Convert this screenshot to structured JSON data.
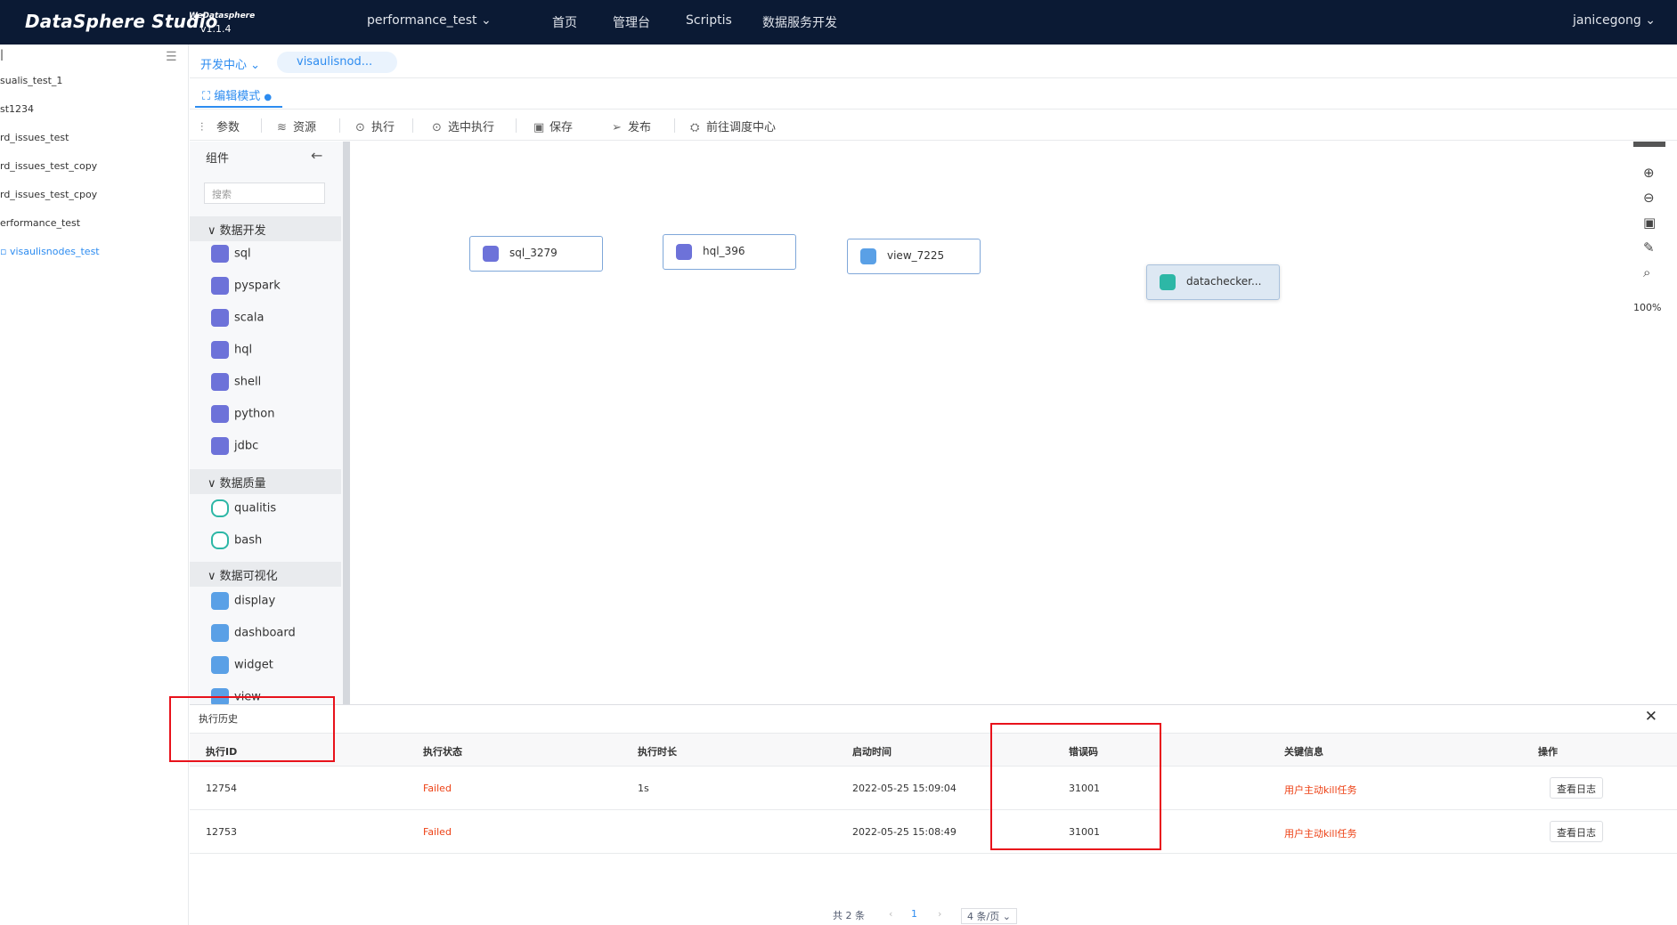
{
  "app": {
    "name": "DataSphere Studio",
    "superscript": "WeDatasphere",
    "version": "v1.1.4"
  },
  "header": {
    "project": "performance_test",
    "nav": [
      "首页",
      "管理台",
      "Scriptis",
      "数据服务开发"
    ],
    "user": "janicegong"
  },
  "workflows": [
    "sualis_test_1",
    "st1234",
    "rd_issues_test",
    "rd_issues_test_copy",
    "rd_issues_test_cpoy",
    "erformance_test",
    "visaulisnodes_test"
  ],
  "tabs": {
    "dev_center": "开发中心",
    "file_tab": "visaulisnod...",
    "mode": "编辑模式"
  },
  "toolbar": [
    "参数",
    "资源",
    "执行",
    "选中执行",
    "保存",
    "发布",
    "前往调度中心"
  ],
  "palette": {
    "title": "组件",
    "search_placeholder": "搜索",
    "groups": [
      {
        "name": "数据开发",
        "items": [
          "sql",
          "pyspark",
          "scala",
          "hql",
          "shell",
          "python",
          "jdbc"
        ]
      },
      {
        "name": "数据质量",
        "items": [
          "qualitis",
          "bash"
        ]
      },
      {
        "name": "数据可视化",
        "items": [
          "display",
          "dashboard",
          "widget",
          "view"
        ]
      }
    ]
  },
  "nodes": [
    "sql_3279",
    "hql_396",
    "view_7225",
    "datachecker..."
  ],
  "canvas": {
    "zoom": "100%"
  },
  "history": {
    "title": "执行历史",
    "columns": [
      "执行ID",
      "执行状态",
      "执行时长",
      "启动时间",
      "错误码",
      "关键信息",
      "操作"
    ],
    "rows": [
      {
        "id": "12754",
        "status": "Failed",
        "duration": "1s",
        "start": "2022-05-25 15:09:04",
        "code": "31001",
        "info": "用户主动kill任务",
        "action": "查看日志"
      },
      {
        "id": "12753",
        "status": "Failed",
        "duration": "",
        "start": "2022-05-25 15:08:49",
        "code": "31001",
        "info": "用户主动kill任务",
        "action": "查看日志"
      }
    ],
    "pager": {
      "total": "共 2 条",
      "page": "1",
      "size": "4 条/页"
    }
  },
  "colors": {
    "accent": "#2d8cf0",
    "topbar": "#0b1a34",
    "failed": "#ed4014",
    "highlight": "#e8121b"
  }
}
